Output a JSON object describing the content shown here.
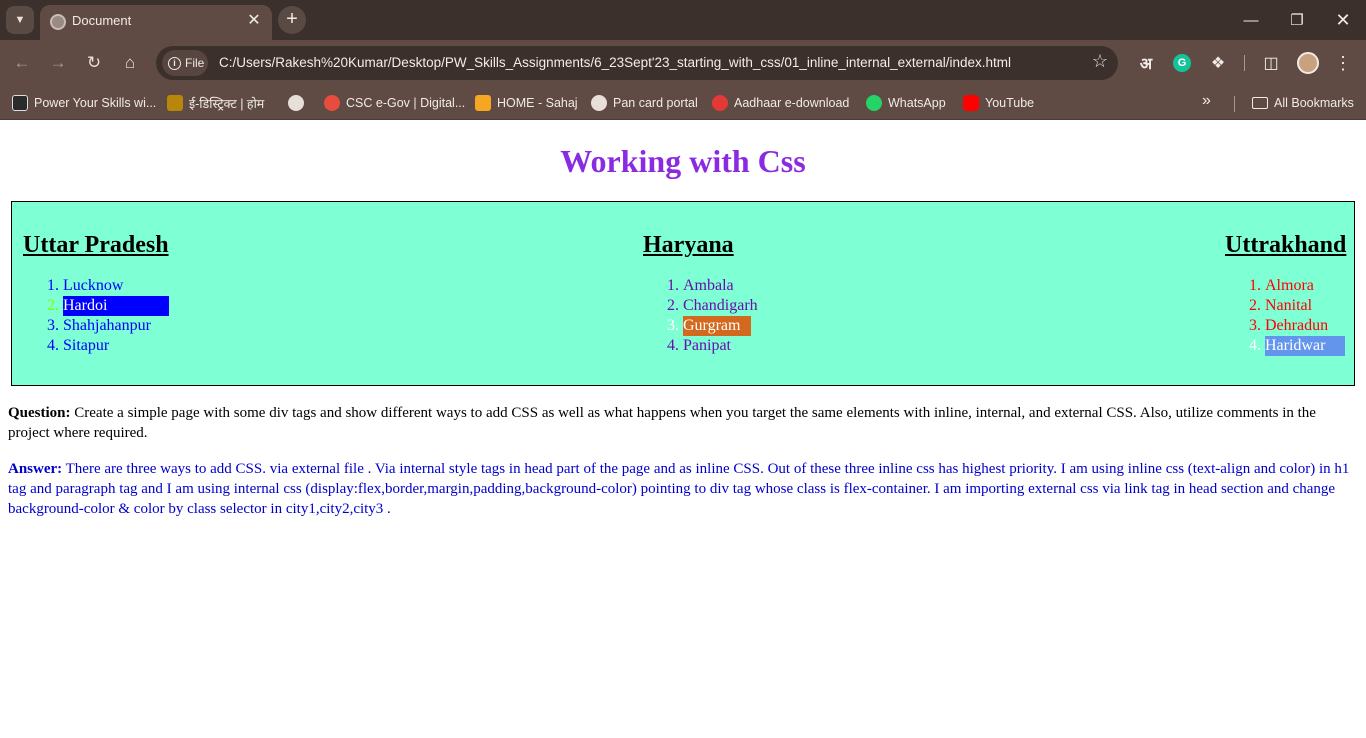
{
  "browser": {
    "tab_title": "Document",
    "file_chip_label": "File",
    "url": "C:/Users/Rakesh%20Kumar/Desktop/PW_Skills_Assignments/6_23Sept'23_starting_with_css/01_inline_internal_external/index.html",
    "hindi_extension_label": "अ",
    "grammarly_label": "G"
  },
  "bookmarks": {
    "items": [
      {
        "label": "Power Your Skills wi...",
        "icon": "pw-skills-icon",
        "color": "#2b2b2b"
      },
      {
        "label": "ई-डिस्ट्रिक्ट | होम",
        "icon": "e-district-icon",
        "color": "#b8860b"
      },
      {
        "label": "",
        "icon": "globe-icon",
        "color": "#e8dfdb"
      },
      {
        "label": "CSC e-Gov | Digital...",
        "icon": "csc-icon",
        "color": "#e74c3c"
      },
      {
        "label": "HOME - Sahaj",
        "icon": "sahaj-icon",
        "color": "#f5a623"
      },
      {
        "label": "Pan card portal",
        "icon": "globe-icon",
        "color": "#e8dfdb"
      },
      {
        "label": "Aadhaar e-download",
        "icon": "aadhaar-icon",
        "color": "#e53935"
      },
      {
        "label": "WhatsApp",
        "icon": "whatsapp-icon",
        "color": "#25d366"
      },
      {
        "label": "YouTube",
        "icon": "youtube-icon",
        "color": "#ff0000"
      }
    ],
    "all_bookmarks_label": "All Bookmarks"
  },
  "page": {
    "title": "Working with Css",
    "states": [
      {
        "name": "Uttar Pradesh",
        "cities": [
          "Lucknow",
          "Hardoi",
          "Shahjahanpur",
          "Sitapur"
        ]
      },
      {
        "name": "Haryana",
        "cities": [
          "Ambala",
          "Chandigarh",
          "Gurgram",
          "Panipat"
        ]
      },
      {
        "name": "Uttrakhand",
        "cities": [
          "Almora",
          "Nanital",
          "Dehradun",
          "Haridwar"
        ]
      }
    ],
    "question_label": "Question:",
    "question_text": " Create a simple page with some div tags and show different ways to add CSS as well as what happens when you target the same elements with inline, internal, and external CSS. Also, utilize comments in the project where required.",
    "answer_label": "Answer:",
    "answer_text": " There are three ways to add CSS. via external file . Via internal style tags in head part of the page and as inline CSS. Out of these three inline css has highest priority. I am using inline css (text-align and color) in h1 tag and paragraph tag and I am using internal css (display:flex,border,margin,padding,background-color) pointing to div tag whose class is flex-container. I am importing external css via link tag in head section and change background-color & color by class selector in city1,city2,city3 ."
  },
  "colors": {
    "title": "#8a2be2",
    "container_bg": "#7fffd4",
    "city1_text": "#0000ff",
    "city2_text": "#6a0dad",
    "city3_text": "#ff0000",
    "answer_text": "#0000cd"
  }
}
